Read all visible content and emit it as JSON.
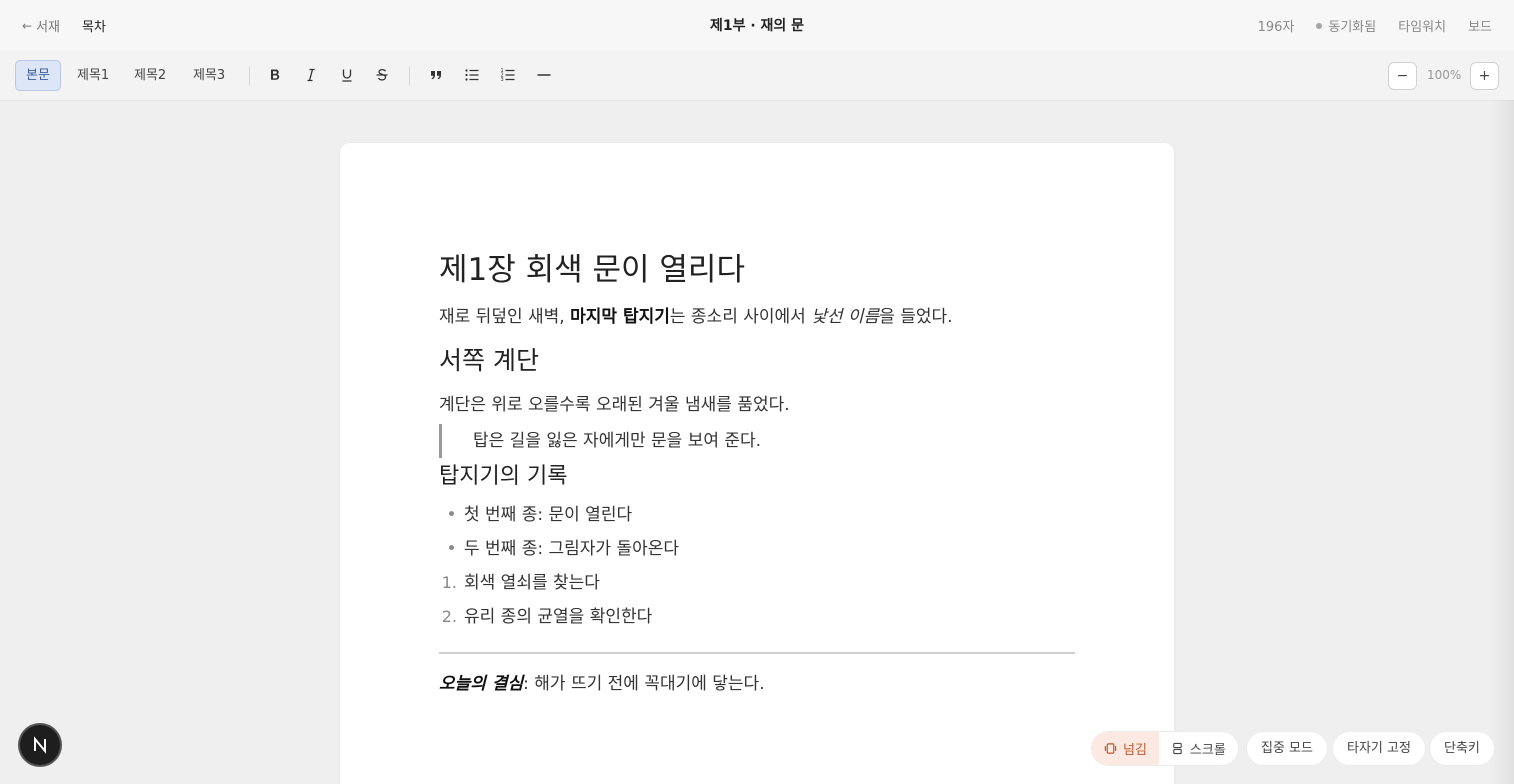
{
  "topbar": {
    "back_label": "서재",
    "back_arrow": "←",
    "toc_label": "목차",
    "title": "제1부 · 재의 문",
    "char_count": "196자",
    "sync_status": "동기화됨",
    "typewriter_label": "타임워치",
    "board_label": "보드"
  },
  "toolbar": {
    "styles": [
      "본문",
      "제목1",
      "제목2",
      "제목3"
    ],
    "active_style": "본문",
    "icons": [
      "bold-icon",
      "italic-icon",
      "underline-icon",
      "strikethrough-icon",
      "quote-icon",
      "bullet-list-icon",
      "numbered-list-icon",
      "divider-icon"
    ],
    "zoom_minus": "−",
    "zoom_plus": "+",
    "zoom_value": "100%"
  },
  "document": {
    "h1": "제1장 회색 문이 열리다",
    "p1": {
      "before": "재로 뒤덮인 새벽, ",
      "bold": "마지막 탑지기",
      "middle": "는 종소리 사이에서 ",
      "italic": "낯선 이름",
      "after": "을 들었다."
    },
    "h2": "서쪽 계단",
    "p2": "계단은 위로 오를수록 오래된 겨울 냄새를 품었다.",
    "quote": "탑은 길을 잃은 자에게만 문을 보여 준다.",
    "h3": "탑지기의 기록",
    "bullets": [
      "첫 번째 종: 문이 열린다",
      "두 번째 종: 그림자가 돌아온다"
    ],
    "numbered": [
      "회색 열쇠를 찾는다",
      "유리 종의 균열을 확인한다"
    ],
    "numbered_marks": [
      "1.",
      "2."
    ],
    "bullet_mark": "•",
    "closing": {
      "emph": "오늘의 결심",
      "rest": ": 해가 뜨기 전에 꼭대기에 닿는다."
    }
  },
  "bottombar": {
    "mode_flip": "넘김",
    "mode_scroll": "스크롤",
    "focus_mode": "집중 모드",
    "typewriter_lock": "타자기 고정",
    "shortcuts": "단축키",
    "badge_letter": "N"
  },
  "colors": {
    "accent_active_style_bg": "#dde6f6",
    "accent_flip": "#c0572f"
  }
}
